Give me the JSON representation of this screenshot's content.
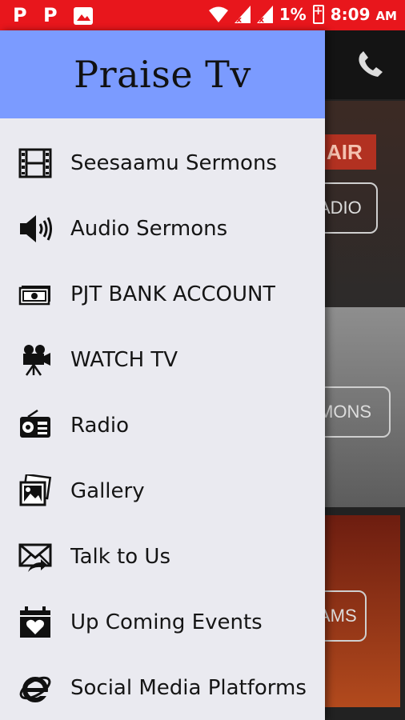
{
  "status_bar": {
    "battery": "1%",
    "time": "8:09",
    "meridiem": "AM",
    "notification_icons": [
      "P",
      "P",
      "gallery-icon"
    ]
  },
  "background": {
    "card1_badge": "AIR",
    "card1_button": "ADIO",
    "card2_button": "MONS",
    "card3_button": "AMS"
  },
  "drawer": {
    "title": "Praise Tv",
    "header_color": "#7b9bff",
    "items": [
      {
        "label": "Seesaamu Sermons",
        "icon": "film-icon"
      },
      {
        "label": "Audio Sermons",
        "icon": "speaker-icon"
      },
      {
        "label": "PJT BANK  ACCOUNT",
        "icon": "money-icon"
      },
      {
        "label": "WATCH TV",
        "icon": "movie-camera-icon"
      },
      {
        "label": "Radio",
        "icon": "radio-icon"
      },
      {
        "label": "Gallery",
        "icon": "gallery-icon"
      },
      {
        "label": "Talk to Us",
        "icon": "mail-icon"
      },
      {
        "label": "Up Coming Events",
        "icon": "calendar-heart-icon"
      },
      {
        "label": "Social Media Platforms",
        "icon": "internet-explorer-icon"
      }
    ]
  },
  "colors": {
    "status_bar": "#e8161c",
    "drawer_bg": "#eaeaf0"
  }
}
